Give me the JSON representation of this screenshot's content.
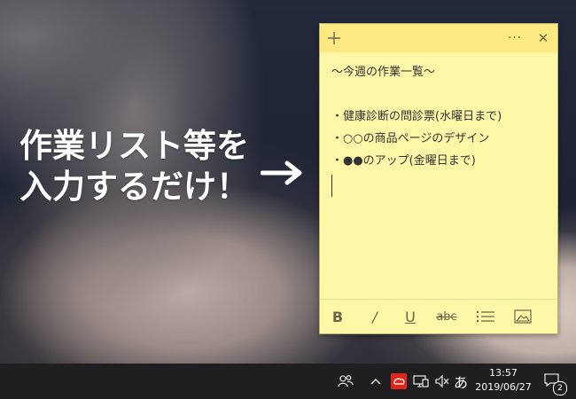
{
  "caption": {
    "line1": "作業リスト等を",
    "line2": "入力するだけ！"
  },
  "note": {
    "titlebar": {
      "add_icon": "plus-icon",
      "menu_icon": "more-icon",
      "close_icon": "close-icon",
      "menu_glyph": "···",
      "close_glyph": "✕"
    },
    "lines": [
      "～今週の作業一覧～",
      "",
      "・健康診断の問診票(水曜日まで)",
      "・○○の商品ページのデザイン",
      "・●●のアップ(金曜日まで)"
    ],
    "toolbar": {
      "bold": "B",
      "italic": "/",
      "underline": "U",
      "strikethrough": "abc"
    },
    "background_color": "#fff7a8",
    "titlebar_color": "#fde982"
  },
  "taskbar": {
    "ime_label": "あ",
    "time": "13:57",
    "date": "2019/06/27",
    "notification_count": "2",
    "tray_icons": [
      "people-icon",
      "chevron-up-icon",
      "adobe-cloud-icon",
      "network-icon",
      "volume-muted-icon",
      "ime-icon",
      "action-center-icon"
    ]
  }
}
